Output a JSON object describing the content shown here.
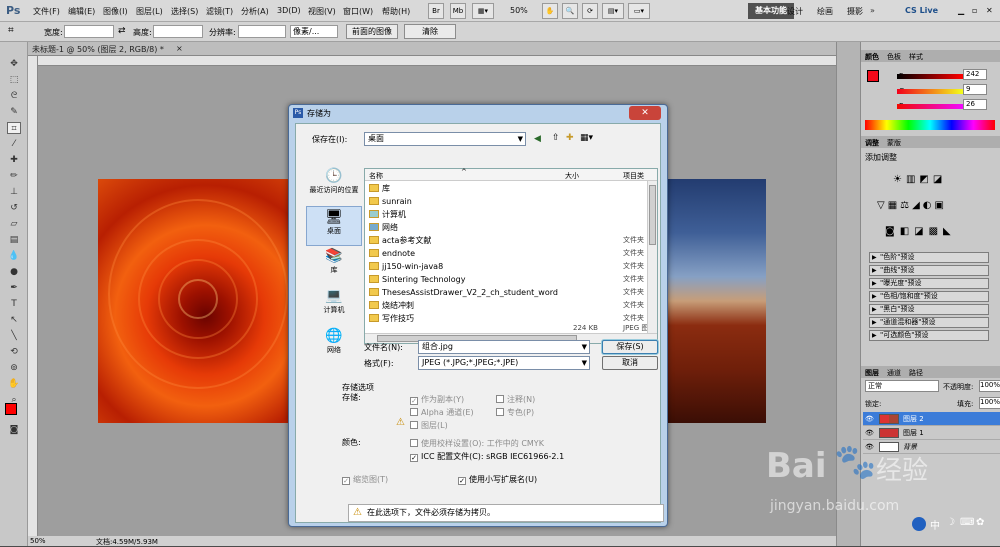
{
  "app": {
    "logo": "Ps"
  },
  "menu": [
    "文件(F)",
    "编辑(E)",
    "图像(I)",
    "图层(L)",
    "选择(S)",
    "滤镜(T)",
    "分析(A)",
    "3D(D)",
    "视图(V)",
    "窗口(W)",
    "帮助(H)"
  ],
  "menubar_controls": {
    "br": "Br",
    "mb": "Mb",
    "zoom": "50%"
  },
  "workspaces": {
    "active": "基本功能",
    "items": [
      "设计",
      "绘画",
      "摄影"
    ],
    "cslive": "CS Live"
  },
  "options_bar": {
    "width_label": "宽度:",
    "height_label": "高度:",
    "resolution_label": "分辨率:",
    "unit": "像素/...",
    "front_image": "前面的图像",
    "clear": "清除"
  },
  "document": {
    "tab": "未标题-1 @ 50% (图层 2, RGB/8) *",
    "status_zoom": "50%",
    "status_doc": "文档:4.59M/5.93M"
  },
  "panels": {
    "color_tabs": [
      "颜色",
      "色板",
      "样式"
    ],
    "rgb": [
      {
        "ch": "R",
        "value": "242"
      },
      {
        "ch": "G",
        "value": "9"
      },
      {
        "ch": "B",
        "value": "26"
      }
    ],
    "adjust_tabs": [
      "调整",
      "蒙版"
    ],
    "adjust_title": "添加调整",
    "presets": [
      "\"色阶\"预设",
      "\"曲线\"预设",
      "\"曝光度\"预设",
      "\"色相/饱和度\"预设",
      "\"黑白\"预设",
      "\"通道混和器\"预设",
      "\"可选颜色\"预设"
    ],
    "layers_tabs": [
      "图层",
      "通道",
      "路径"
    ],
    "blend": "正常",
    "opacity_label": "不透明度:",
    "opacity": "100%",
    "lock_label": "锁定:",
    "fill_label": "填充:",
    "fill": "100%",
    "layers": [
      {
        "name": "图层 2"
      },
      {
        "name": "图层 1"
      },
      {
        "name": "背景"
      }
    ]
  },
  "dialog": {
    "title": "存储为",
    "save_in_label": "保存在(I):",
    "save_in_value": "桌面",
    "places": [
      "最近访问的位置",
      "桌面",
      "库",
      "计算机",
      "网络"
    ],
    "col_name": "名称",
    "col_size": "大小",
    "col_type": "项目类",
    "files": [
      {
        "name": "库",
        "type": ""
      },
      {
        "name": "sunrain",
        "type": ""
      },
      {
        "name": "计算机",
        "type": ""
      },
      {
        "name": "网络",
        "type": ""
      },
      {
        "name": "acta参考文献",
        "type": "文件夹"
      },
      {
        "name": "endnote",
        "type": "文件夹"
      },
      {
        "name": "jj150-win-java8",
        "type": "文件夹"
      },
      {
        "name": "Sintering Technology",
        "type": "文件夹"
      },
      {
        "name": "ThesesAssistDrawer_V2_2_ch_student_word",
        "type": "文件夹"
      },
      {
        "name": "烧结冲刺",
        "type": "文件夹"
      },
      {
        "name": "写作技巧",
        "type": "文件夹"
      }
    ],
    "partial_row": {
      "size": "224 KB",
      "type": "JPEG 图"
    },
    "filename_label": "文件名(N):",
    "filename_value": "组合.jpg",
    "format_label": "格式(F):",
    "format_value": "JPEG (*.JPG;*.JPEG;*.JPE)",
    "save_button": "保存(S)",
    "cancel_button": "取消",
    "options_title": "存储选项",
    "store_label": "存储:",
    "as_copy": "作为副本(Y)",
    "notes": "注释(N)",
    "alpha": "Alpha 通道(E)",
    "spot": "专色(P)",
    "layers": "图层(L)",
    "color_label": "颜色:",
    "proof": "使用校样设置(O): 工作中的 CMYK",
    "icc": "ICC 配置文件(C): sRGB IEC61966-2.1",
    "thumbnail": "缩览图(T)",
    "lowercase_ext": "使用小写扩展名(U)",
    "warning": "在此选项下，文件必须存储为拷贝。"
  },
  "watermark": {
    "brand": "Bai",
    "brand2": "经验",
    "url": "jingyan.baidu.com"
  },
  "taskbar": {
    "ime": "中"
  }
}
